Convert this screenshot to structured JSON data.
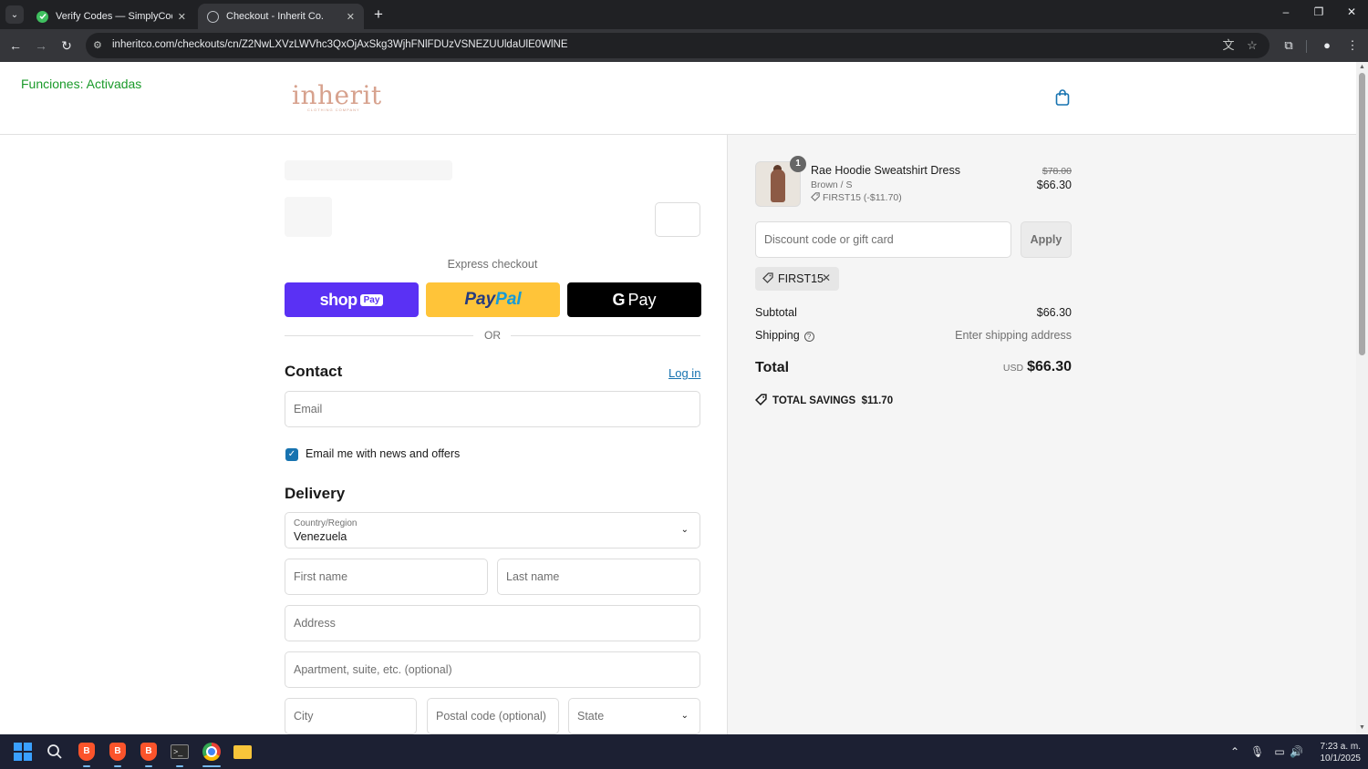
{
  "browser": {
    "tabs": [
      {
        "label": "Verify Codes — SimplyCodes",
        "icon": "simplycodes-check-icon"
      },
      {
        "label": "Checkout - Inherit Co.",
        "icon": "globe-icon"
      }
    ],
    "url": "inheritco.com/checkouts/cn/Z2NwLXVzLWVhc3QxOjAxSkg3WjhFNlFDUzVSNEZUUldaUlE0WlNE"
  },
  "extension": {
    "status": "Funciones: Activadas"
  },
  "header": {
    "logo": "inherit",
    "logo_sub": "CLOTHING COMPANY"
  },
  "express": {
    "title": "Express checkout",
    "shop_word": "shop",
    "shop_badge": "Pay",
    "paypal_part1": "Pay",
    "paypal_part2": "Pal",
    "gpay_g": "G",
    "gpay_label": "Pay",
    "or_label": "OR"
  },
  "contact": {
    "title": "Contact",
    "login": "Log in",
    "email_placeholder": "Email",
    "newsletter_label": "Email me with news and offers",
    "newsletter_checked": true
  },
  "delivery": {
    "title": "Delivery",
    "country_label": "Country/Region",
    "country_value": "Venezuela",
    "first_name": "First name",
    "last_name": "Last name",
    "address": "Address",
    "apartment": "Apartment, suite, etc. (optional)",
    "city": "City",
    "postal": "Postal code (optional)",
    "state": "State"
  },
  "order": {
    "item": {
      "quantity": "1",
      "name": "Rae Hoodie Sweatshirt Dress",
      "variant": "Brown / S",
      "discount": "FIRST15 (-$11.70)",
      "original_price": "$78.00",
      "price": "$66.30"
    },
    "discount_placeholder": "Discount code or gift card",
    "apply_label": "Apply",
    "applied_code": "FIRST15",
    "subtotal_label": "Subtotal",
    "subtotal_value": "$66.30",
    "shipping_label": "Shipping",
    "shipping_value": "Enter shipping address",
    "total_label": "Total",
    "currency": "USD",
    "total_value": "$66.30",
    "savings_label": "TOTAL SAVINGS",
    "savings_value": "$11.70"
  },
  "taskbar": {
    "time": "7:23 a. m.",
    "date": "10/1/2025"
  },
  "colors": {
    "shop_pay": "#5a31f4",
    "paypal": "#ffc439",
    "link": "#1773b0",
    "extension_green": "#1a9a2a",
    "logo": "#d7a28e"
  }
}
